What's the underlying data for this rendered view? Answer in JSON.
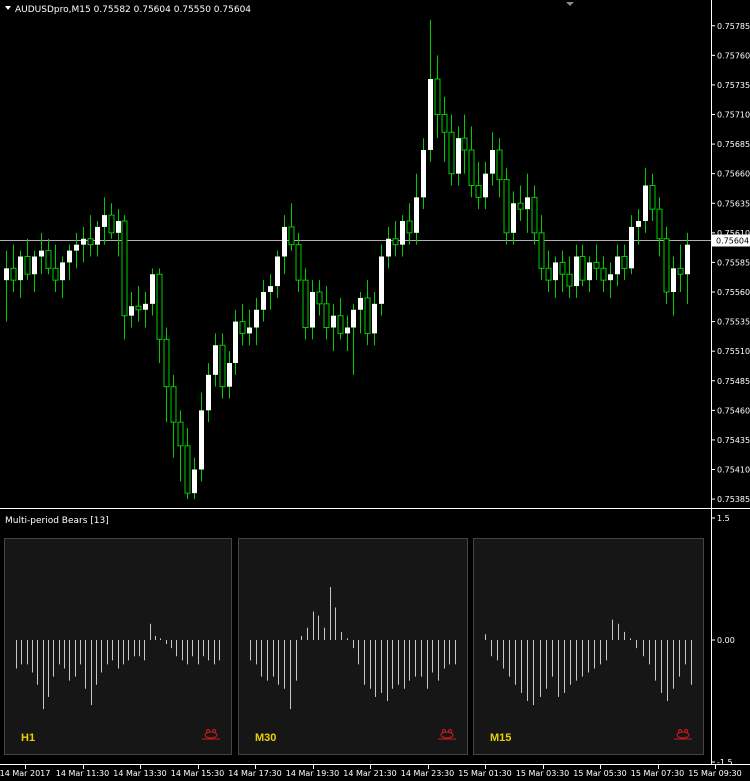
{
  "window": {
    "symbol_info": "AUDUSDpro,M15  0.75582 0.75604 0.75550 0.75604"
  },
  "colors": {
    "background": "#000000",
    "bull_candle": "#ffffff",
    "wick": "#00cc00",
    "axis": "#ffffff",
    "bid_line": "#b0b0b0",
    "panel_bg": "#161616",
    "panel_border": "#444444",
    "histogram_bar": "#c8c8c8",
    "panel_label": "#e8d000",
    "bear_icon": "#cc1a1a"
  },
  "chart_data": [
    {
      "type": "candlestick",
      "symbol": "AUDUSDpro",
      "timeframe": "M15",
      "current_price_label": "0.75604",
      "y_ticks": [
        "0.75785",
        "0.75760",
        "0.75735",
        "0.75710",
        "0.75685",
        "0.75660",
        "0.75635",
        "0.75610",
        "0.75585",
        "0.75560",
        "0.75535",
        "0.75510",
        "0.75485",
        "0.75460",
        "0.75435",
        "0.75410",
        "0.75385"
      ],
      "ylim": [
        0.7538,
        0.758
      ],
      "x_labels": [
        "14 Mar 2017",
        "14 Mar 11:30",
        "14 Mar 13:30",
        "14 Mar 15:30",
        "14 Mar 17:30",
        "14 Mar 19:30",
        "14 Mar 21:30",
        "14 Mar 23:30",
        "15 Mar 01:30",
        "15 Mar 03:30",
        "15 Mar 05:30",
        "15 Mar 07:30",
        "15 Mar 09:30"
      ],
      "candles": [
        [
          0.7557,
          0.75595,
          0.75535,
          0.7558
        ],
        [
          0.7558,
          0.756,
          0.7556,
          0.7557
        ],
        [
          0.7557,
          0.75595,
          0.75555,
          0.7559
        ],
        [
          0.7559,
          0.75605,
          0.7557,
          0.75575
        ],
        [
          0.75575,
          0.75595,
          0.7556,
          0.7559
        ],
        [
          0.7559,
          0.7561,
          0.75575,
          0.75595
        ],
        [
          0.75595,
          0.75605,
          0.75575,
          0.7558
        ],
        [
          0.7558,
          0.756,
          0.7556,
          0.7557
        ],
        [
          0.7557,
          0.7559,
          0.75555,
          0.75585
        ],
        [
          0.75585,
          0.756,
          0.7557,
          0.75595
        ],
        [
          0.75595,
          0.7561,
          0.7558,
          0.756
        ],
        [
          0.756,
          0.75615,
          0.75585,
          0.75605
        ],
        [
          0.75605,
          0.75625,
          0.7559,
          0.756
        ],
        [
          0.756,
          0.7562,
          0.7559,
          0.75615
        ],
        [
          0.75615,
          0.7564,
          0.756,
          0.75625
        ],
        [
          0.75625,
          0.75635,
          0.75605,
          0.7561
        ],
        [
          0.7561,
          0.7563,
          0.7559,
          0.7562
        ],
        [
          0.7562,
          0.75625,
          0.7552,
          0.7554
        ],
        [
          0.7554,
          0.7556,
          0.7553,
          0.75548
        ],
        [
          0.75548,
          0.75565,
          0.75535,
          0.75545
        ],
        [
          0.75545,
          0.7556,
          0.7553,
          0.7555
        ],
        [
          0.7555,
          0.7558,
          0.7554,
          0.75575
        ],
        [
          0.75575,
          0.7558,
          0.755,
          0.7552
        ],
        [
          0.7552,
          0.7553,
          0.7545,
          0.7548
        ],
        [
          0.7548,
          0.7549,
          0.7542,
          0.7545
        ],
        [
          0.7545,
          0.7546,
          0.754,
          0.7543
        ],
        [
          0.7543,
          0.75445,
          0.75385,
          0.7539
        ],
        [
          0.7539,
          0.7542,
          0.75385,
          0.7541
        ],
        [
          0.7541,
          0.75475,
          0.754,
          0.7546
        ],
        [
          0.7546,
          0.755,
          0.7545,
          0.7549
        ],
        [
          0.7549,
          0.75525,
          0.7548,
          0.75515
        ],
        [
          0.75515,
          0.75525,
          0.7547,
          0.7548
        ],
        [
          0.7548,
          0.7551,
          0.7547,
          0.755
        ],
        [
          0.755,
          0.75545,
          0.7549,
          0.75535
        ],
        [
          0.75535,
          0.7555,
          0.75515,
          0.75525
        ],
        [
          0.75525,
          0.75545,
          0.75515,
          0.7553
        ],
        [
          0.7553,
          0.75555,
          0.75515,
          0.75545
        ],
        [
          0.75545,
          0.7557,
          0.75535,
          0.7556
        ],
        [
          0.7556,
          0.75575,
          0.75545,
          0.75565
        ],
        [
          0.75565,
          0.75595,
          0.75555,
          0.7559
        ],
        [
          0.7559,
          0.75625,
          0.75575,
          0.75615
        ],
        [
          0.75615,
          0.75635,
          0.75595,
          0.756
        ],
        [
          0.756,
          0.7561,
          0.7556,
          0.7557
        ],
        [
          0.7557,
          0.7558,
          0.7552,
          0.7553
        ],
        [
          0.7553,
          0.7557,
          0.7552,
          0.7556
        ],
        [
          0.7556,
          0.7557,
          0.7554,
          0.7555
        ],
        [
          0.7555,
          0.75565,
          0.7552,
          0.7553
        ],
        [
          0.7553,
          0.7555,
          0.7551,
          0.7554
        ],
        [
          0.7554,
          0.75555,
          0.7552,
          0.75525
        ],
        [
          0.75525,
          0.7554,
          0.7551,
          0.7553
        ],
        [
          0.7553,
          0.7555,
          0.7549,
          0.75545
        ],
        [
          0.75545,
          0.7556,
          0.75525,
          0.75555
        ],
        [
          0.75555,
          0.7557,
          0.75515,
          0.75525
        ],
        [
          0.75525,
          0.7556,
          0.75515,
          0.7555
        ],
        [
          0.7555,
          0.756,
          0.7554,
          0.7559
        ],
        [
          0.7559,
          0.75615,
          0.7558,
          0.75605
        ],
        [
          0.75605,
          0.7562,
          0.7559,
          0.756
        ],
        [
          0.756,
          0.75625,
          0.7559,
          0.7562
        ],
        [
          0.7562,
          0.75635,
          0.756,
          0.7561
        ],
        [
          0.7561,
          0.7566,
          0.756,
          0.7564
        ],
        [
          0.7564,
          0.7569,
          0.7563,
          0.7568
        ],
        [
          0.7568,
          0.7579,
          0.7567,
          0.7574
        ],
        [
          0.7574,
          0.7576,
          0.7569,
          0.7571
        ],
        [
          0.7571,
          0.75725,
          0.7567,
          0.75695
        ],
        [
          0.75695,
          0.7571,
          0.7565,
          0.7566
        ],
        [
          0.7566,
          0.757,
          0.7565,
          0.7569
        ],
        [
          0.7569,
          0.7571,
          0.7566,
          0.7568
        ],
        [
          0.7568,
          0.757,
          0.7564,
          0.7565
        ],
        [
          0.7565,
          0.7567,
          0.7563,
          0.7564
        ],
        [
          0.7564,
          0.7567,
          0.7563,
          0.7566
        ],
        [
          0.7566,
          0.75695,
          0.7565,
          0.7568
        ],
        [
          0.7568,
          0.7569,
          0.7564,
          0.75655
        ],
        [
          0.75655,
          0.75665,
          0.756,
          0.7561
        ],
        [
          0.7561,
          0.75645,
          0.756,
          0.75635
        ],
        [
          0.75635,
          0.7565,
          0.7562,
          0.7563
        ],
        [
          0.7563,
          0.7566,
          0.7561,
          0.7564
        ],
        [
          0.7564,
          0.7565,
          0.756,
          0.7561
        ],
        [
          0.7561,
          0.75625,
          0.7557,
          0.7558
        ],
        [
          0.7558,
          0.75595,
          0.7556,
          0.7557
        ],
        [
          0.7557,
          0.7559,
          0.75555,
          0.75585
        ],
        [
          0.75585,
          0.75595,
          0.7556,
          0.75575
        ],
        [
          0.75575,
          0.7559,
          0.75555,
          0.75565
        ],
        [
          0.75565,
          0.756,
          0.75555,
          0.7559
        ],
        [
          0.7559,
          0.756,
          0.75565,
          0.7557
        ],
        [
          0.7557,
          0.7559,
          0.7556,
          0.75585
        ],
        [
          0.75585,
          0.756,
          0.7557,
          0.7558
        ],
        [
          0.7558,
          0.7559,
          0.7556,
          0.7557
        ],
        [
          0.7557,
          0.75585,
          0.75555,
          0.75575
        ],
        [
          0.75575,
          0.756,
          0.75565,
          0.7559
        ],
        [
          0.7559,
          0.756,
          0.7557,
          0.7558
        ],
        [
          0.7558,
          0.75625,
          0.75575,
          0.75615
        ],
        [
          0.75615,
          0.7563,
          0.756,
          0.7562
        ],
        [
          0.7562,
          0.75665,
          0.7561,
          0.7565
        ],
        [
          0.7565,
          0.7566,
          0.7562,
          0.7563
        ],
        [
          0.7563,
          0.7564,
          0.7559,
          0.75605
        ],
        [
          0.75605,
          0.75615,
          0.7555,
          0.7556
        ],
        [
          0.7556,
          0.7559,
          0.7554,
          0.7558
        ],
        [
          0.7558,
          0.756,
          0.7556,
          0.75575
        ],
        [
          0.75575,
          0.7561,
          0.7555,
          0.756
        ]
      ]
    },
    {
      "type": "bar",
      "indicator": "Multi-period Bears [13]",
      "y_ticks": [
        "1.5",
        "0.00",
        "-1.5"
      ],
      "ylim": [
        -1.5,
        1.5
      ],
      "panels": [
        {
          "label": "H1",
          "values": [
            -0.35,
            -0.3,
            -0.3,
            -0.4,
            -0.55,
            -0.85,
            -0.7,
            -0.45,
            -0.3,
            -0.35,
            -0.5,
            -0.45,
            -0.3,
            -0.6,
            -0.8,
            -0.55,
            -0.4,
            -0.3,
            -0.25,
            -0.35,
            -0.3,
            -0.25,
            -0.2,
            -0.2,
            -0.25,
            0.2,
            0.05,
            0.02,
            -0.05,
            -0.1,
            -0.2,
            -0.25,
            -0.3,
            -0.2,
            -0.3,
            -0.2,
            -0.25,
            -0.3,
            -0.25
          ]
        },
        {
          "label": "M30",
          "values": [
            -0.25,
            -0.3,
            -0.45,
            -0.5,
            -0.45,
            -0.55,
            -0.6,
            -0.85,
            -0.5,
            0.05,
            0.15,
            0.35,
            0.3,
            0.15,
            0.65,
            0.4,
            0.1,
            0.02,
            -0.1,
            -0.3,
            -0.55,
            -0.6,
            -0.7,
            -0.65,
            -0.75,
            -0.6,
            -0.55,
            -0.6,
            -0.5,
            -0.45,
            -0.45,
            -0.6,
            -0.4,
            -0.5,
            -0.35,
            -0.3,
            -0.3
          ]
        },
        {
          "label": "M15",
          "values": [
            0.07,
            -0.2,
            -0.25,
            -0.35,
            -0.45,
            -0.55,
            -0.65,
            -0.75,
            -0.8,
            -0.7,
            -0.6,
            -0.45,
            -0.7,
            -0.65,
            -0.55,
            -0.5,
            -0.45,
            -0.4,
            -0.35,
            -0.3,
            -0.25,
            0.25,
            0.2,
            0.1,
            0.02,
            -0.1,
            -0.2,
            -0.3,
            -0.5,
            -0.65,
            -0.75,
            -0.6,
            -0.45,
            -0.3,
            -0.55
          ]
        }
      ]
    }
  ]
}
